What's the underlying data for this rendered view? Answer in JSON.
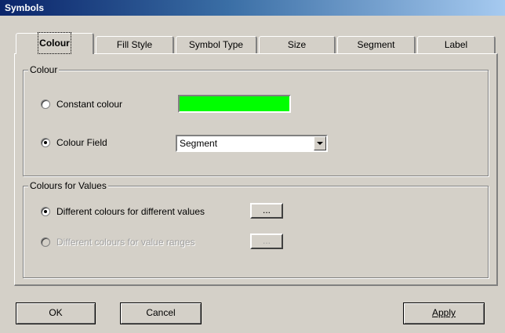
{
  "window": {
    "title": "Symbols"
  },
  "tabs": [
    {
      "label": "Colour",
      "active": true
    },
    {
      "label": "Fill Style",
      "active": false
    },
    {
      "label": "Symbol Type",
      "active": false
    },
    {
      "label": "Size",
      "active": false
    },
    {
      "label": "Segment",
      "active": false
    },
    {
      "label": "Label",
      "active": false
    }
  ],
  "colour_group": {
    "legend": "Colour",
    "constant_label": "Constant colour",
    "constant_selected": false,
    "swatch_color": "#00ff00",
    "field_label": "Colour Field",
    "field_selected": true,
    "field_value": "Segment"
  },
  "values_group": {
    "legend": "Colours for Values",
    "different_label": "Different colours for different values",
    "different_selected": true,
    "ranges_label": "Different colours for value ranges",
    "ranges_enabled": false,
    "ellipsis": "..."
  },
  "buttons": {
    "ok": "OK",
    "cancel": "Cancel",
    "apply": "Apply"
  },
  "icons": {
    "dropdown": "chevron-down-icon"
  }
}
